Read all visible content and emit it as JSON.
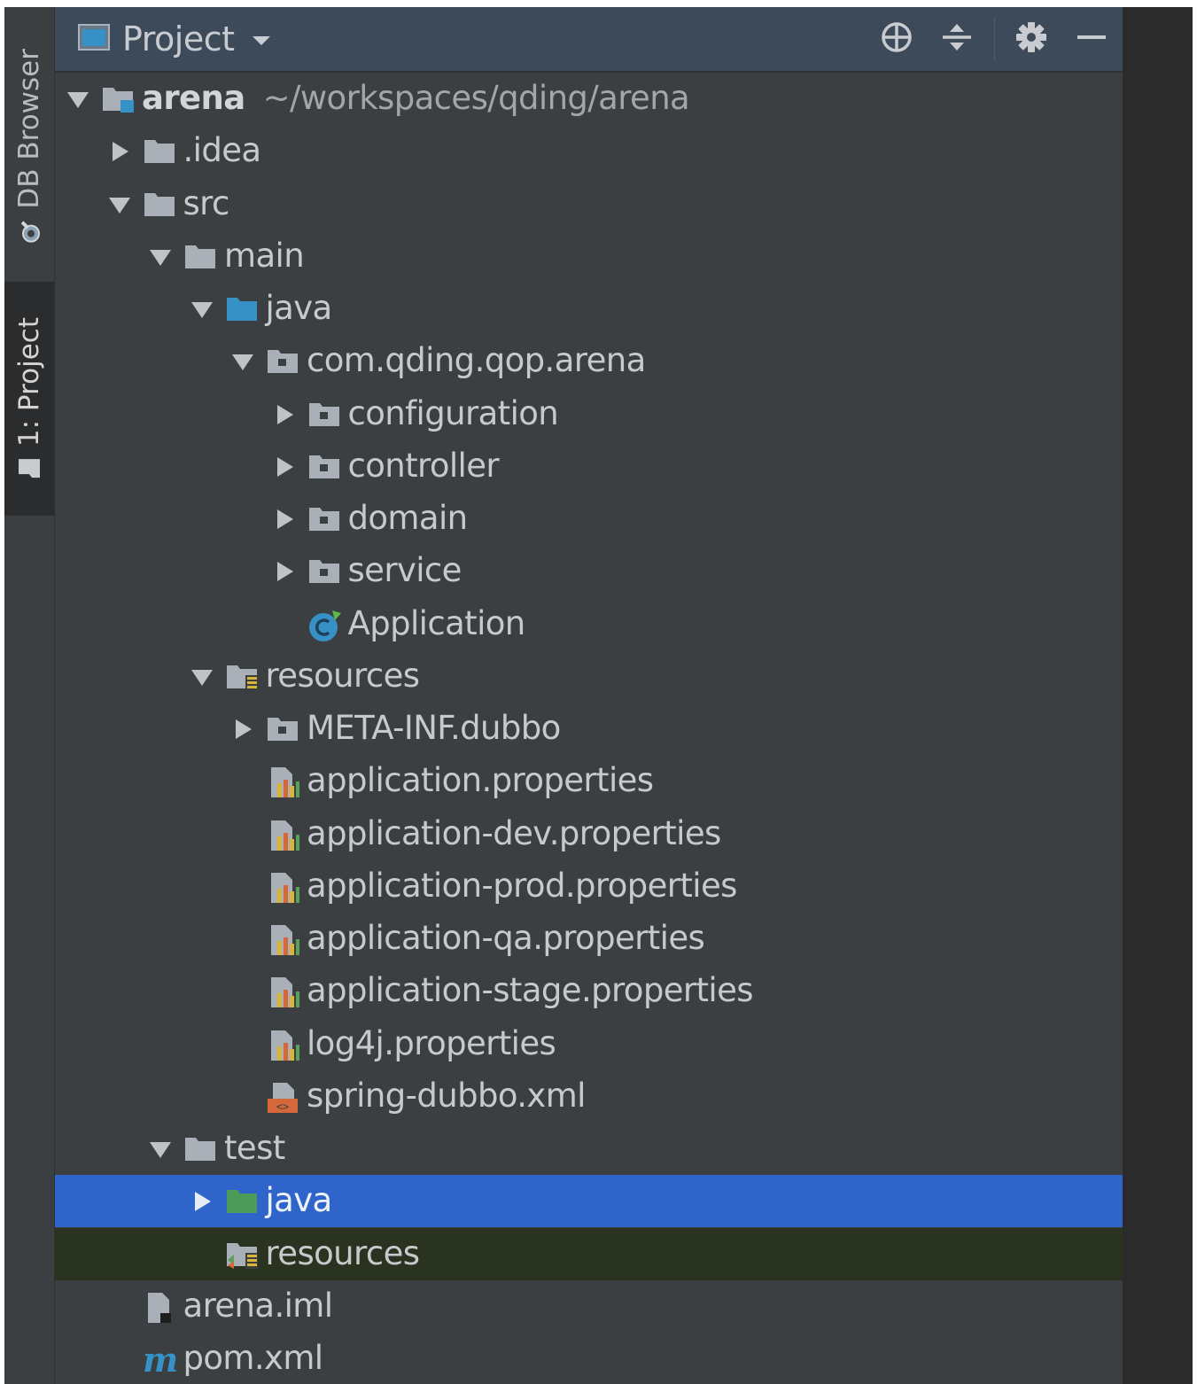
{
  "side_strip": {
    "db_browser_label": "DB Browser",
    "project_tab_label": "1: Project"
  },
  "header": {
    "title": "Project",
    "locate_icon": "crosshair-icon",
    "collapse_icon": "collapse-all-icon",
    "settings_icon": "gear-icon",
    "hide_icon": "minimize-icon"
  },
  "colors": {
    "header_bg": "#3d4a59",
    "panel_bg": "#3c3f41",
    "selection": "#2f65ca",
    "hover_row": "#29331f",
    "source_folder": "#3591c6",
    "test_folder": "#4e9a5a",
    "text": "#c6cacd"
  },
  "tree": [
    {
      "label": "arena",
      "path": "~/workspaces/qding/arena",
      "depth": 0,
      "arrow": "down",
      "icon": "module-folder-icon",
      "bold": true
    },
    {
      "label": ".idea",
      "depth": 1,
      "arrow": "right",
      "icon": "folder-icon"
    },
    {
      "label": "src",
      "depth": 1,
      "arrow": "down",
      "icon": "folder-icon"
    },
    {
      "label": "main",
      "depth": 2,
      "arrow": "down",
      "icon": "folder-icon"
    },
    {
      "label": "java",
      "depth": 3,
      "arrow": "down",
      "icon": "source-folder-icon"
    },
    {
      "label": "com.qding.qop.arena",
      "depth": 4,
      "arrow": "down",
      "icon": "package-icon"
    },
    {
      "label": "configuration",
      "depth": 5,
      "arrow": "right",
      "icon": "package-icon"
    },
    {
      "label": "controller",
      "depth": 5,
      "arrow": "right",
      "icon": "package-icon"
    },
    {
      "label": "domain",
      "depth": 5,
      "arrow": "right",
      "icon": "package-icon"
    },
    {
      "label": "service",
      "depth": 5,
      "arrow": "right",
      "icon": "package-icon"
    },
    {
      "label": "Application",
      "depth": 5,
      "arrow": "none",
      "icon": "spring-class-icon"
    },
    {
      "label": "resources",
      "depth": 3,
      "arrow": "down",
      "icon": "resources-folder-icon"
    },
    {
      "label": "META-INF.dubbo",
      "depth": 4,
      "arrow": "right",
      "icon": "package-icon"
    },
    {
      "label": "application.properties",
      "depth": 4,
      "arrow": "none",
      "icon": "properties-file-icon"
    },
    {
      "label": "application-dev.properties",
      "depth": 4,
      "arrow": "none",
      "icon": "properties-file-icon"
    },
    {
      "label": "application-prod.properties",
      "depth": 4,
      "arrow": "none",
      "icon": "properties-file-icon"
    },
    {
      "label": "application-qa.properties",
      "depth": 4,
      "arrow": "none",
      "icon": "properties-file-icon"
    },
    {
      "label": "application-stage.properties",
      "depth": 4,
      "arrow": "none",
      "icon": "properties-file-icon"
    },
    {
      "label": "log4j.properties",
      "depth": 4,
      "arrow": "none",
      "icon": "properties-file-icon"
    },
    {
      "label": "spring-dubbo.xml",
      "depth": 4,
      "arrow": "none",
      "icon": "xml-file-icon"
    },
    {
      "label": "test",
      "depth": 2,
      "arrow": "down",
      "icon": "folder-icon"
    },
    {
      "label": "java",
      "depth": 3,
      "arrow": "right",
      "icon": "test-source-folder-icon",
      "selected": true
    },
    {
      "label": "resources",
      "depth": 3,
      "arrow": "none",
      "icon": "test-resources-folder-icon",
      "hover": true
    },
    {
      "label": "arena.iml",
      "depth": 1,
      "arrow": "none",
      "icon": "iml-file-icon"
    },
    {
      "label": "pom.xml",
      "depth": 1,
      "arrow": "none",
      "icon": "maven-file-icon"
    }
  ]
}
